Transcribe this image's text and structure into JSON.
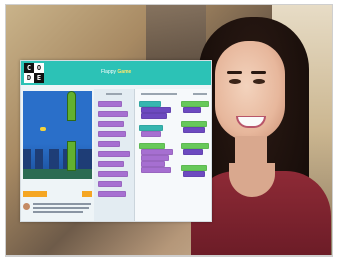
{
  "app": {
    "logo_letters": [
      "C",
      "O",
      "D",
      "E"
    ],
    "title_prefix": "Flappy",
    "title_suffix": "Game"
  },
  "colors": {
    "header": "#2cc2b6",
    "blocks": [
      "#a66fd1",
      "#37b6b0",
      "#67c95a",
      "#6d4ac0"
    ],
    "run_button": "#f5a623",
    "pipe": "#62b12f",
    "sky": "#2a6fc9",
    "presenter_top": "#8e2a36"
  },
  "icons": {
    "bird": "flappy-bird-icon",
    "pipe": "pipe-obstacle-icon",
    "avatar": "avatar-icon"
  }
}
